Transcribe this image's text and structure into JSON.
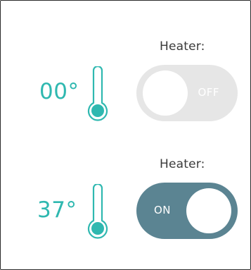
{
  "colors": {
    "accent_teal": "#2fb8b0",
    "toggle_on": "#5b8492",
    "toggle_off": "#e6e6e6",
    "label_text": "#3a3a3a"
  },
  "heaters": [
    {
      "label": "Heater:",
      "temperature": "00°",
      "switch_state": "OFF",
      "icon": "thermometer-icon"
    },
    {
      "label": "Heater:",
      "temperature": "37°",
      "switch_state": "ON",
      "icon": "thermometer-icon"
    }
  ]
}
